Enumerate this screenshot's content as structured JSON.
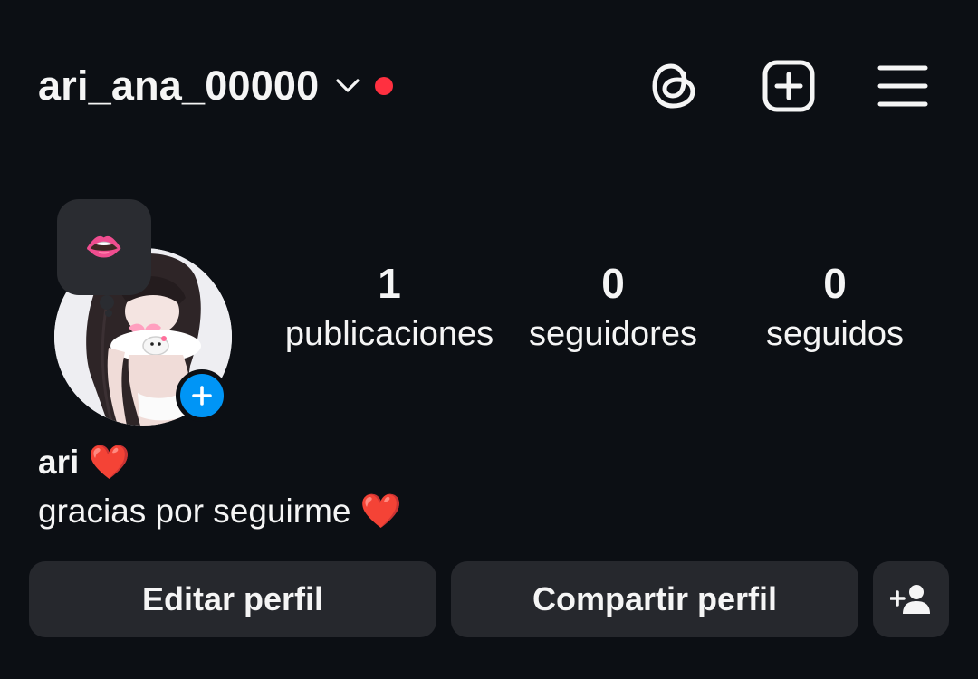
{
  "header": {
    "username": "ari_ana_00000",
    "icons": {
      "dropdown": "chevron-down-icon",
      "notification": "red-dot",
      "threads": "threads-icon",
      "new_post": "plus-square-icon",
      "menu": "hamburger-menu-icon"
    }
  },
  "profile": {
    "note": "👄",
    "avatar": "profile-photo",
    "add_story_icon": "plus-icon",
    "display_name": "ari ❤️",
    "bio": "gracias por seguirme ❤️"
  },
  "stats": [
    {
      "number": "1",
      "label": "publicaciones"
    },
    {
      "number": "0",
      "label": "seguidores"
    },
    {
      "number": "0",
      "label": "seguidos"
    }
  ],
  "buttons": {
    "edit": "Editar perfil",
    "share": "Compartir perfil",
    "discover_icon": "add-person-icon"
  },
  "colors": {
    "background": "#0c0f14",
    "button_bg": "#26282d",
    "accent_blue": "#0095f6",
    "notification_red": "#ff3040",
    "text": "#f5f5f5"
  }
}
